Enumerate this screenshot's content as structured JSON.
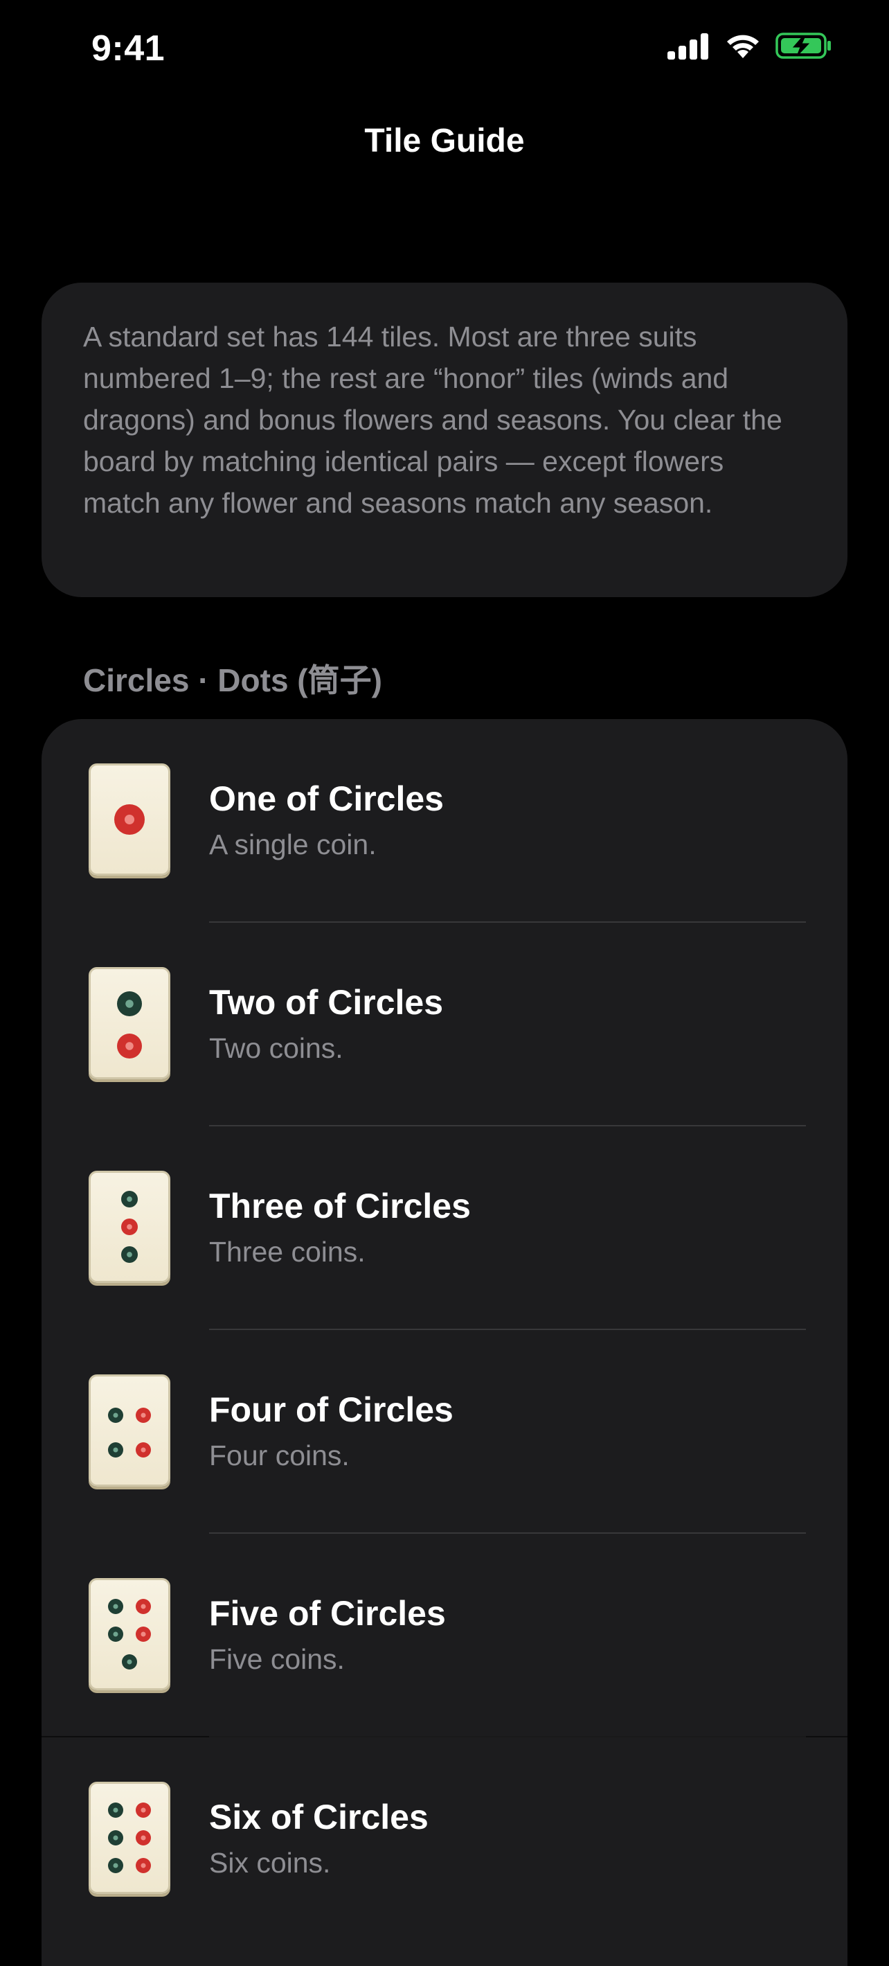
{
  "status_bar": {
    "time": "9:41",
    "icons": [
      "cellular-signal-icon",
      "wifi-icon",
      "battery-charging-icon"
    ],
    "battery_color": "#34c759"
  },
  "nav": {
    "title": "Tile Guide"
  },
  "intro": {
    "text": "A standard set has 144 tiles. Most are three suits numbered 1–9; the rest are “honor” tiles (winds and dragons) and bonus flowers and seasons. You clear the board by matching identical pairs — except flowers match any flower and seasons match any season."
  },
  "section": {
    "header": "Circles · Dots (筒子)",
    "items": [
      {
        "title": "One of Circles",
        "subtitle": "A single coin.",
        "dots": 1
      },
      {
        "title": "Two of Circles",
        "subtitle": "Two coins.",
        "dots": 2
      },
      {
        "title": "Three of Circles",
        "subtitle": "Three coins.",
        "dots": 3
      },
      {
        "title": "Four of Circles",
        "subtitle": "Four coins.",
        "dots": 4
      },
      {
        "title": "Five of Circles",
        "subtitle": "Five coins.",
        "dots": 5
      },
      {
        "title": "Six of Circles",
        "subtitle": "Six coins.",
        "dots": 6
      }
    ]
  },
  "colors": {
    "background": "#000000",
    "card": "#1c1c1e",
    "secondary_text": "#8e8e93",
    "tile_face": "#f4eedb",
    "dot_red": "#d0312d",
    "dot_green": "#1f3f34"
  }
}
